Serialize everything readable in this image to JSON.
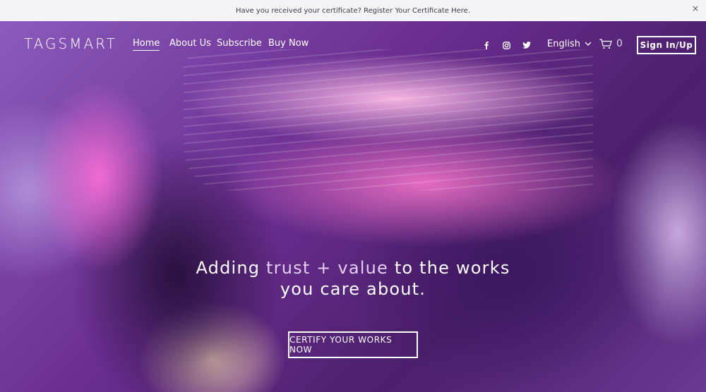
{
  "announcement": {
    "text": "Have you received your certificate? Register Your Certificate Here.",
    "close_glyph": "×"
  },
  "header": {
    "logo": "TAGSMART",
    "nav": [
      {
        "label": "Home",
        "active": true
      },
      {
        "label": "About Us",
        "active": false
      },
      {
        "label": "Subscribe",
        "active": false
      },
      {
        "label": "Buy Now",
        "active": false
      }
    ],
    "social_icons": [
      "facebook-icon",
      "instagram-icon",
      "twitter-icon"
    ],
    "language": "English",
    "cart_count": "0",
    "signin_label": "Sign In/Up"
  },
  "hero": {
    "headline_part1": "Adding ",
    "headline_highlight": "trust + value",
    "headline_part2": " to the works",
    "headline_line2": "you care about.",
    "cta_label": "CERTIFY YOUR WORKS NOW"
  },
  "colors": {
    "announcement_bg": "#f4f4f6",
    "highlight_text": "#e3cdf2",
    "hero_purple": "#5a2d7a",
    "hero_pink": "#e46bc2"
  }
}
